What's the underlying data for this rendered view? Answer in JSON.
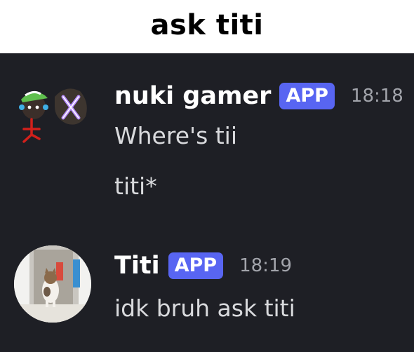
{
  "caption": "ask titi",
  "messages": [
    {
      "author": "nuki gamer",
      "badge": "APP",
      "time": "18:18",
      "lines": [
        "Where's tii",
        "titi*"
      ]
    },
    {
      "author": "Titi",
      "badge": "APP",
      "time": "18:19",
      "lines": [
        "idk bruh ask titi"
      ]
    }
  ],
  "colors": {
    "background": "#1e1f25",
    "badge": "#5865f2",
    "timestamp": "#a2a4ab",
    "message_text": "#d9dadd"
  }
}
